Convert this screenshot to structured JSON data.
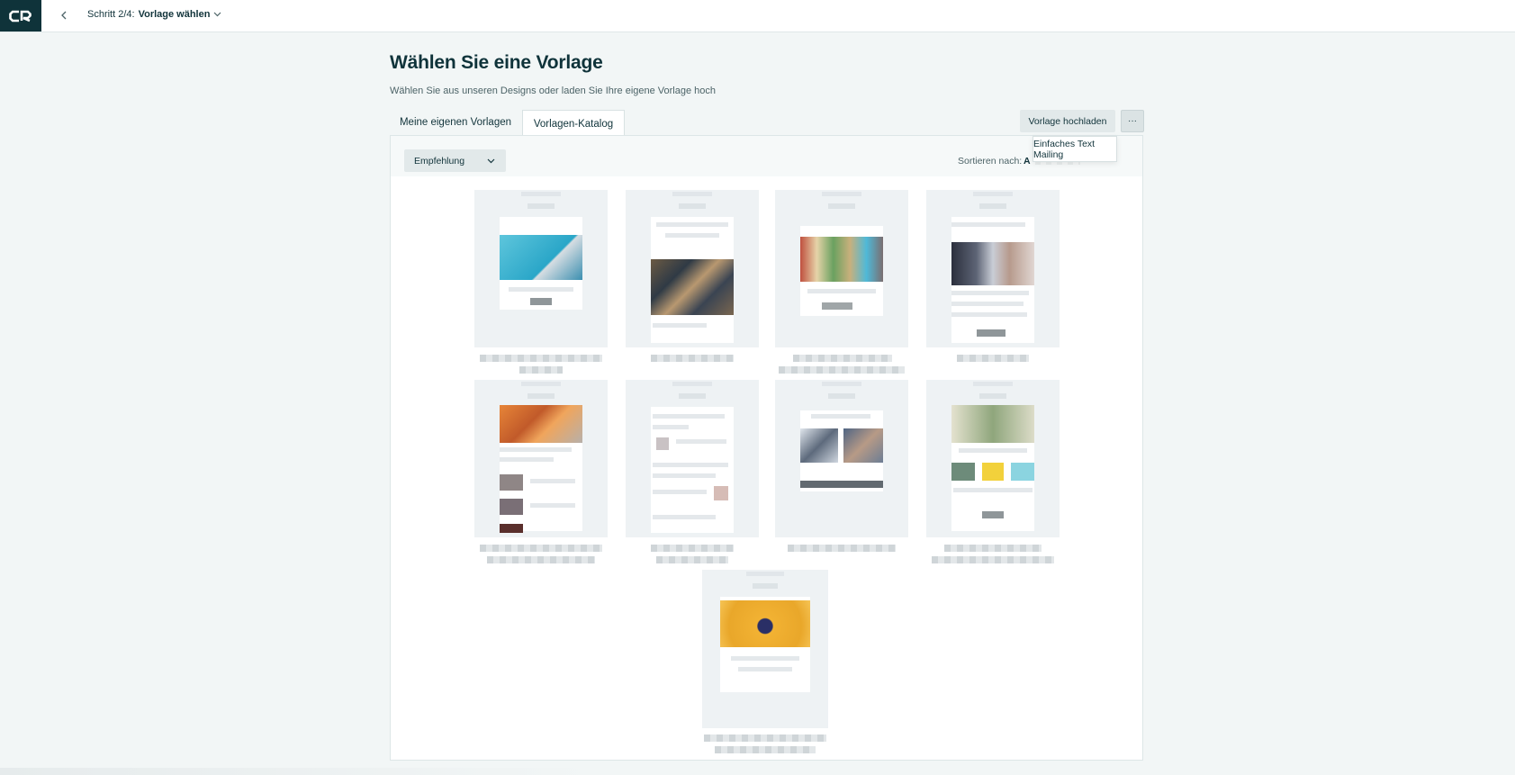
{
  "header": {
    "step_prefix": "Schritt 2/4:",
    "step_title": "Vorlage wählen"
  },
  "page": {
    "title": "Wählen Sie eine Vorlage",
    "subtitle": "Wählen Sie aus unseren Designs oder laden Sie Ihre eigene Vorlage hoch"
  },
  "tabs": [
    {
      "label": "Meine eigenen Vorlagen",
      "active": false
    },
    {
      "label": "Vorlagen-Katalog",
      "active": true
    }
  ],
  "actions": {
    "upload_label": "Vorlage hochladen",
    "more_label": "···",
    "menu_item": "Einfaches Text Mailing"
  },
  "filter": {
    "selected": "Empfehlung",
    "sort_label": "Sortieren nach:",
    "sort_value_visible": "A"
  },
  "colors": {
    "brand_dark": "#0f333a",
    "background": "#f2f6f6",
    "button_bg": "#e2e9ea"
  },
  "templates_count": 9
}
